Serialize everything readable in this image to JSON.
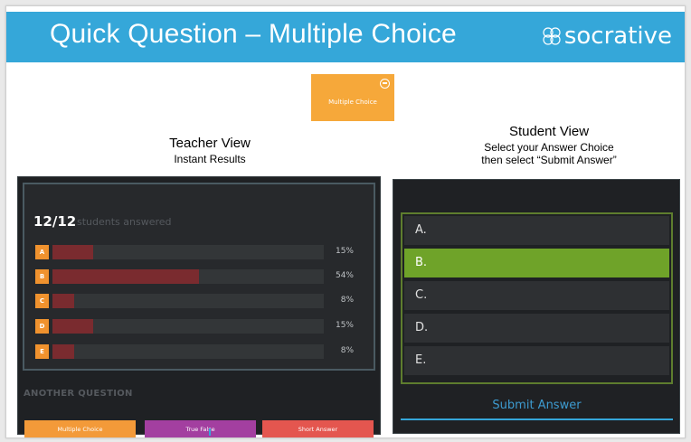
{
  "banner": {
    "title": "Quick Question – Multiple Choice",
    "brand": "socrative",
    "color": "#35a7d9"
  },
  "tile": {
    "label": "Multiple Choice",
    "color": "#f6a83a",
    "icon": "minus-circle-icon"
  },
  "teacher": {
    "heading": "Teacher View",
    "subheading": "Instant Results",
    "count": "12/12",
    "count_label": "students answered",
    "results": [
      {
        "letter": "A",
        "percent_label": "15%",
        "value": 15
      },
      {
        "letter": "B",
        "percent_label": "54%",
        "value": 54
      },
      {
        "letter": "C",
        "percent_label": "8%",
        "value": 8
      },
      {
        "letter": "D",
        "percent_label": "15%",
        "value": 15
      },
      {
        "letter": "E",
        "percent_label": "8%",
        "value": 8
      }
    ],
    "another_question": "ANOTHER QUESTION",
    "buttons": {
      "multiple_choice": "Multiple Choice",
      "true_false": "True False",
      "short_answer": "Short Answer"
    }
  },
  "student": {
    "heading": "Student View",
    "line1": "Select your Answer Choice",
    "line2": "then select “Submit Answer”",
    "choices": [
      "A.",
      "B.",
      "C.",
      "D.",
      "E."
    ],
    "selected": "B.",
    "submit_label": "Submit Answer"
  }
}
